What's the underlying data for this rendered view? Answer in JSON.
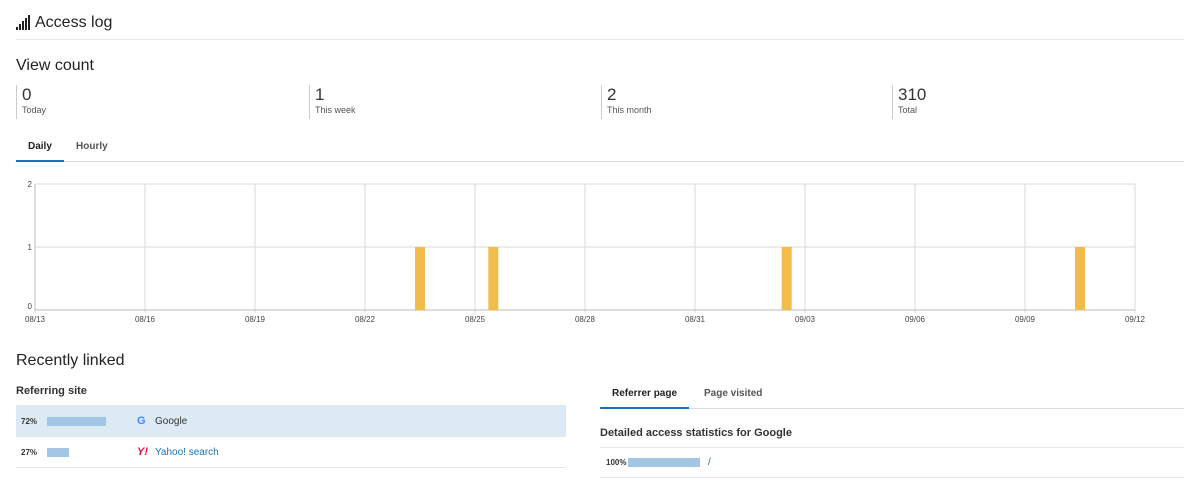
{
  "header": {
    "title": "Access log",
    "icon": "signal-bars-icon"
  },
  "view_count": {
    "title": "View count",
    "stats": [
      {
        "value": "0",
        "label": "Today"
      },
      {
        "value": "1",
        "label": "This week"
      },
      {
        "value": "2",
        "label": "This month"
      },
      {
        "value": "310",
        "label": "Total"
      }
    ]
  },
  "chart_tabs": {
    "items": [
      "Daily",
      "Hourly"
    ],
    "active": 0
  },
  "chart_data": {
    "type": "bar",
    "x_ticks": [
      "08/13",
      "08/16",
      "08/19",
      "08/22",
      "08/25",
      "08/28",
      "08/31",
      "09/03",
      "09/06",
      "09/09",
      "09/12"
    ],
    "x_range": [
      "08/13",
      "09/12"
    ],
    "series": [
      {
        "dates": [
          "08/23",
          "08/25",
          "09/02",
          "09/10"
        ],
        "values": [
          1,
          1,
          1,
          1
        ]
      }
    ],
    "y_ticks": [
      0,
      1,
      2
    ],
    "ylim": [
      0,
      2
    ],
    "bar_color": "#f0bd4b",
    "grid": true
  },
  "recently_linked": {
    "title": "Recently linked",
    "referring_site": {
      "header": "Referring site",
      "rows": [
        {
          "percent_label": "72%",
          "percent": 72,
          "icon": "google-icon",
          "icon_glyph": "G",
          "icon_color": "#4285f4",
          "name": "Google",
          "name_color": "#333333",
          "active": true
        },
        {
          "percent_label": "27%",
          "percent": 27,
          "icon": "yahoo-icon",
          "icon_glyph": "Y!",
          "icon_color": "#e0123b",
          "name": "Yahoo! search",
          "name_color": "#1a73b8",
          "active": false
        }
      ]
    },
    "tabs": {
      "items": [
        "Referrer page",
        "Page visited"
      ],
      "active": 0
    },
    "detail": {
      "title": "Detailed access statistics for Google",
      "rows": [
        {
          "percent_label": "100%",
          "percent": 100,
          "link": "/"
        }
      ]
    }
  },
  "colors": {
    "accent": "#1a73b8",
    "bar": "#f0bd4b",
    "percent_bar": "#a3c6e4",
    "active_row": "#dceaf3"
  }
}
